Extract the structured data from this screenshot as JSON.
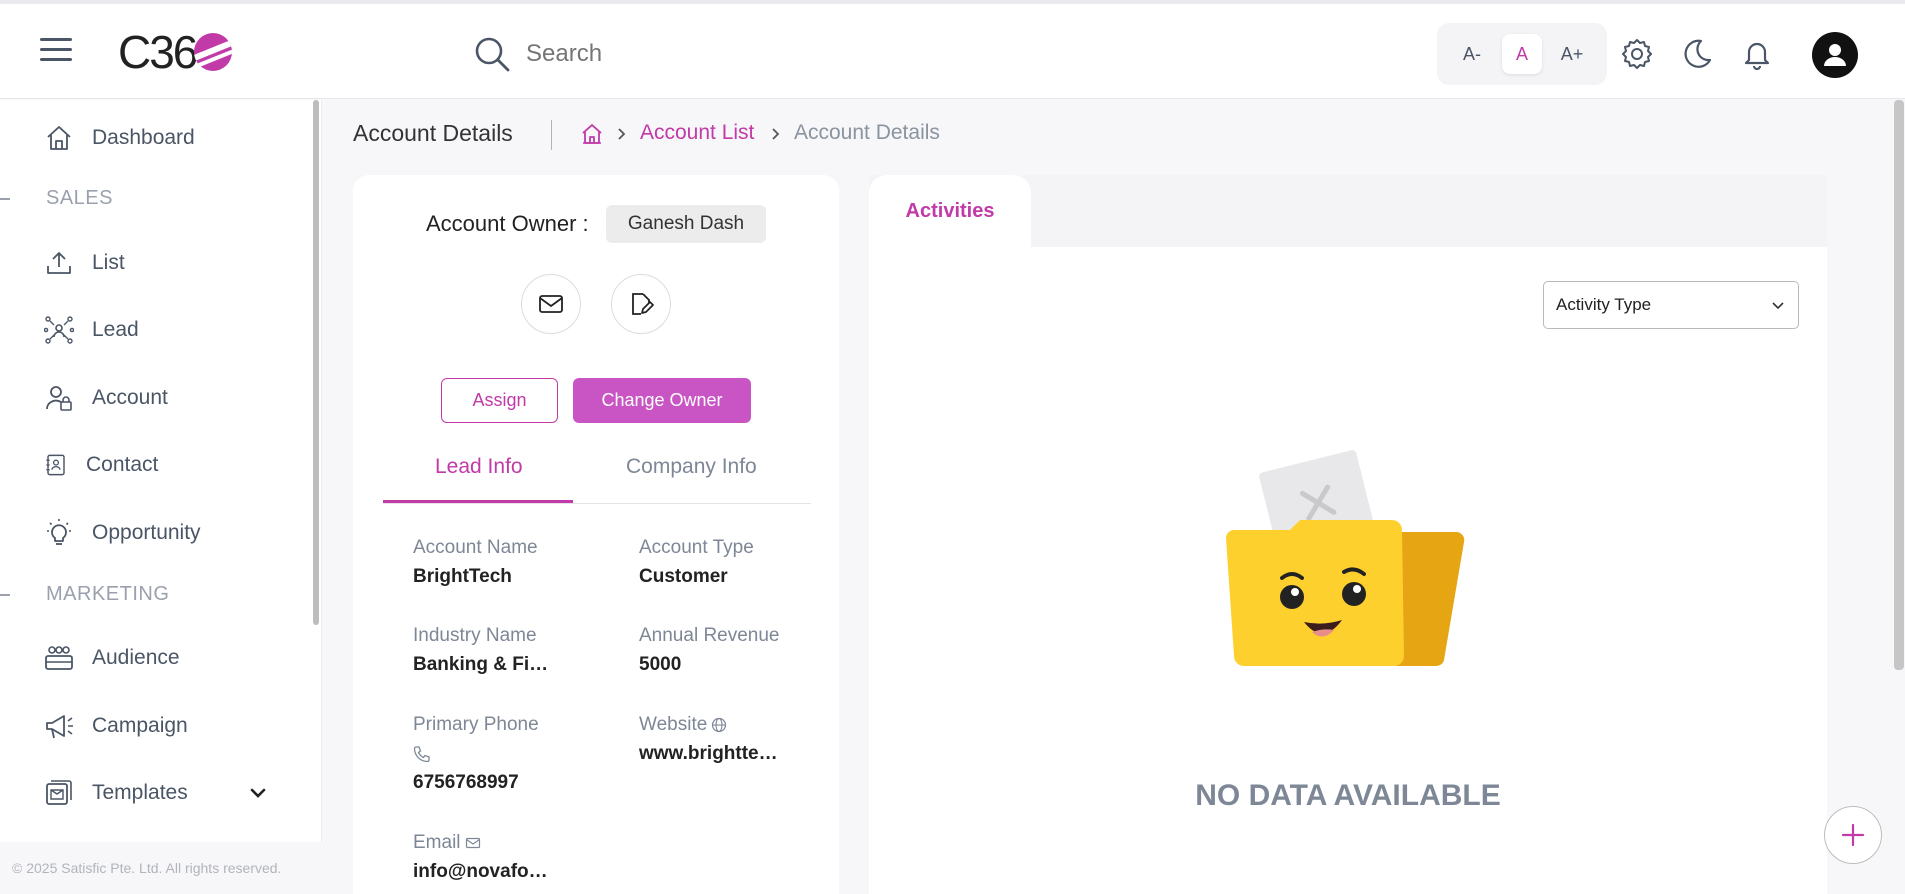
{
  "header": {
    "logo_text": "C36",
    "search_placeholder": "Search",
    "font_controls": [
      "A-",
      "A",
      "A+"
    ]
  },
  "sidebar": {
    "items": [
      {
        "label": "Dashboard",
        "icon": "home-icon"
      },
      {
        "label": "List",
        "icon": "upload-icon"
      },
      {
        "label": "Lead",
        "icon": "network-icon"
      },
      {
        "label": "Account",
        "icon": "user-lock-icon"
      },
      {
        "label": "Contact",
        "icon": "contact-book-icon"
      },
      {
        "label": "Opportunity",
        "icon": "lightbulb-icon"
      },
      {
        "label": "Audience",
        "icon": "group-icon"
      },
      {
        "label": "Campaign",
        "icon": "megaphone-icon"
      },
      {
        "label": "Templates",
        "icon": "template-icon"
      }
    ],
    "sections": [
      "SALES",
      "MARKETING"
    ],
    "footer": "© 2025 Satisfic Pte. Ltd. All rights reserved."
  },
  "breadcrumb": {
    "page_title": "Account Details",
    "link": "Account List",
    "current": "Account Details"
  },
  "account": {
    "owner_label": "Account Owner :",
    "owner_name": "Ganesh Dash",
    "assign_label": "Assign",
    "change_owner_label": "Change Owner",
    "tabs": [
      "Lead Info",
      "Company Info"
    ],
    "fields": {
      "account_name_label": "Account Name",
      "account_name": "BrightTech",
      "account_type_label": "Account Type",
      "account_type": "Customer",
      "industry_label": "Industry Name",
      "industry": "Banking & Fin...",
      "revenue_label": "Annual Revenue",
      "revenue": "5000",
      "phone_label": "Primary Phone",
      "phone": "6756768997",
      "website_label": "Website",
      "website": "www.brighttec...",
      "email_label": "Email",
      "email": "info@novafoo..."
    }
  },
  "activities": {
    "tab_label": "Activities",
    "select_value": "Activity Type",
    "empty_text": "NO DATA AVAILABLE"
  },
  "colors": {
    "accent": "#c13aa8",
    "button_fill": "#c955c4",
    "muted_text": "#7d8796"
  }
}
